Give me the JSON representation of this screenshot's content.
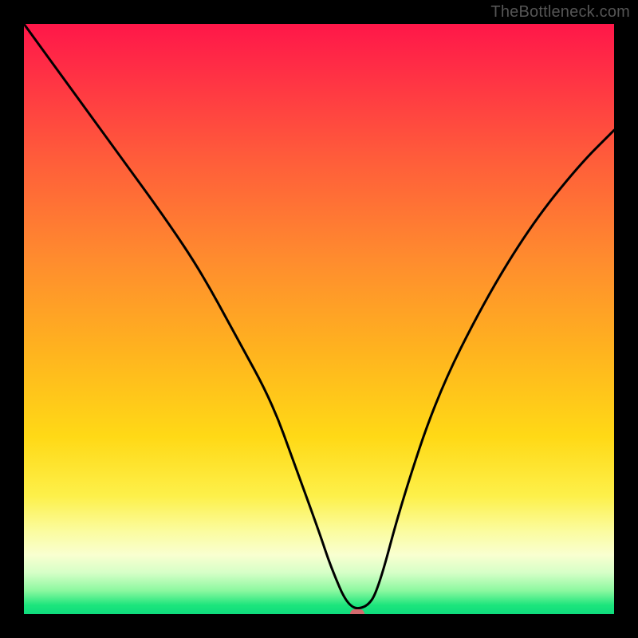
{
  "watermark": "TheBottleneck.com",
  "chart_data": {
    "type": "line",
    "title": "",
    "xlabel": "",
    "ylabel": "",
    "xlim": [
      0,
      100
    ],
    "ylim": [
      0,
      100
    ],
    "background_gradient": {
      "top": "#ff1749",
      "midUpper": "#ff8c2e",
      "mid": "#ffd916",
      "midLower": "#fbfca0",
      "bottom": "#0fdc7d"
    },
    "grid": false,
    "legend": false,
    "series": [
      {
        "name": "bottleneck-curve",
        "stroke": "#000000",
        "x": [
          0,
          8,
          16,
          24,
          30,
          36,
          42,
          46,
          50,
          52,
          55,
          58,
          60,
          64,
          70,
          78,
          86,
          94,
          100
        ],
        "y": [
          100,
          89,
          78,
          67,
          58,
          47,
          36,
          25,
          14,
          8,
          1,
          1,
          4,
          19,
          37,
          53,
          66,
          76,
          82
        ]
      }
    ],
    "marker": {
      "name": "optimal-point",
      "color": "#d46a6e",
      "x": 56.5,
      "y": 0
    }
  },
  "colors": {
    "frame": "#000000",
    "watermark": "#555555"
  }
}
